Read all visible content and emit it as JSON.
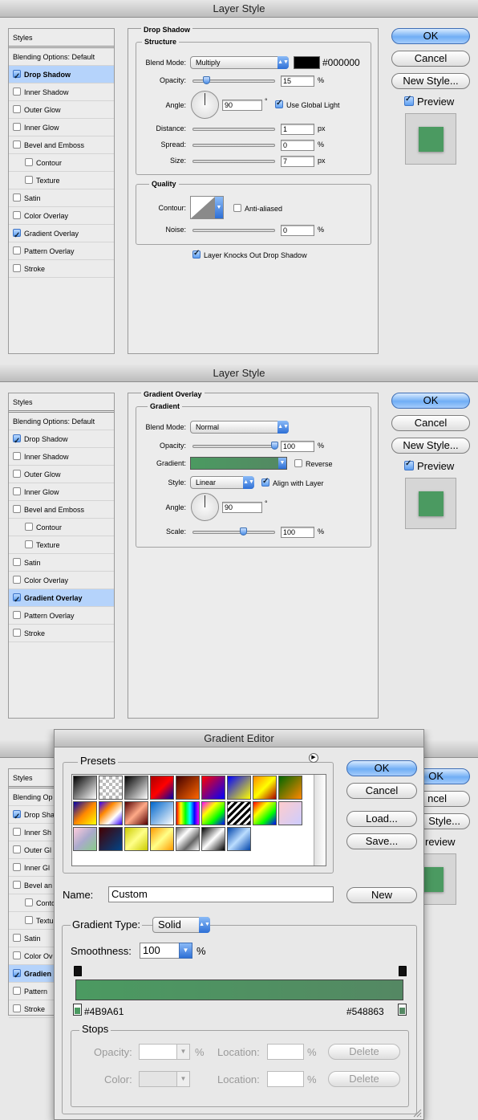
{
  "dialog1": {
    "title": "Layer Style",
    "list": [
      {
        "label": "Styles",
        "type": "header"
      },
      {
        "label": "Blending Options: Default",
        "type": "plain"
      },
      {
        "label": "Drop Shadow",
        "checked": true,
        "selected": true
      },
      {
        "label": "Inner Shadow",
        "checked": false
      },
      {
        "label": "Outer Glow",
        "checked": false
      },
      {
        "label": "Inner Glow",
        "checked": false
      },
      {
        "label": "Bevel and Emboss",
        "checked": false
      },
      {
        "label": "Contour",
        "checked": false,
        "indent": true
      },
      {
        "label": "Texture",
        "checked": false,
        "indent": true
      },
      {
        "label": "Satin",
        "checked": false
      },
      {
        "label": "Color Overlay",
        "checked": false
      },
      {
        "label": "Gradient Overlay",
        "checked": true
      },
      {
        "label": "Pattern Overlay",
        "checked": false
      },
      {
        "label": "Stroke",
        "checked": false
      }
    ],
    "section_title": "Drop Shadow",
    "structure": "Structure",
    "blend_mode_label": "Blend Mode:",
    "blend_mode": "Multiply",
    "shadow_color_hex": "#000000",
    "opacity_label": "Opacity:",
    "opacity": "15",
    "opacity_pct": 15,
    "percent": "%",
    "angle_label": "Angle:",
    "angle": "90",
    "degree": "°",
    "use_global_light": "Use Global Light",
    "distance_label": "Distance:",
    "distance": "1",
    "distance_pct": 1,
    "spread_label": "Spread:",
    "spread": "0",
    "spread_pct": 0,
    "size_label": "Size:",
    "size": "7",
    "size_pct": 7,
    "px": "px",
    "quality": "Quality",
    "contour_label": "Contour:",
    "anti_aliased": "Anti-aliased",
    "noise_label": "Noise:",
    "noise": "0",
    "noise_pct": 0,
    "knocks_out": "Layer Knocks Out Drop Shadow",
    "ok": "OK",
    "cancel": "Cancel",
    "new_style": "New Style...",
    "preview": "Preview",
    "preview_color": "#4b9a61"
  },
  "dialog2": {
    "title": "Layer Style",
    "list": [
      {
        "label": "Styles",
        "type": "header"
      },
      {
        "label": "Blending Options: Default",
        "type": "plain"
      },
      {
        "label": "Drop Shadow",
        "checked": true
      },
      {
        "label": "Inner Shadow",
        "checked": false
      },
      {
        "label": "Outer Glow",
        "checked": false
      },
      {
        "label": "Inner Glow",
        "checked": false
      },
      {
        "label": "Bevel and Emboss",
        "checked": false
      },
      {
        "label": "Contour",
        "checked": false,
        "indent": true
      },
      {
        "label": "Texture",
        "checked": false,
        "indent": true
      },
      {
        "label": "Satin",
        "checked": false
      },
      {
        "label": "Color Overlay",
        "checked": false
      },
      {
        "label": "Gradient Overlay",
        "checked": true,
        "selected": true
      },
      {
        "label": "Pattern Overlay",
        "checked": false
      },
      {
        "label": "Stroke",
        "checked": false
      }
    ],
    "section_title": "Gradient Overlay",
    "gradient": "Gradient",
    "blend_mode_label": "Blend Mode:",
    "blend_mode": "Normal",
    "opacity_label": "Opacity:",
    "opacity": "100",
    "opacity_pct": 100,
    "percent": "%",
    "gradient_label": "Gradient:",
    "reverse": "Reverse",
    "style_label": "Style:",
    "style": "Linear",
    "align_with_layer": "Align with Layer",
    "angle_label": "Angle:",
    "angle": "90",
    "degree": "°",
    "scale_label": "Scale:",
    "scale": "100",
    "scale_pct": 50,
    "ok": "OK",
    "cancel": "Cancel",
    "new_style": "New Style...",
    "preview": "Preview"
  },
  "dialog3_background_list": [
    "Styles",
    "Blending Op",
    "Drop Sha",
    "Inner Sh",
    "Outer Gl",
    "Inner Gl",
    "Bevel an",
    "Conto",
    "Textu",
    "Satin",
    "Color Ov",
    "Gradien",
    "Pattern",
    "Stroke"
  ],
  "dialog3_background_buttons": {
    "ok": "OK",
    "cancel": "ncel",
    "new_style": "Style...",
    "preview": "review"
  },
  "gradient_editor": {
    "title": "Gradient Editor",
    "presets": "Presets",
    "ok": "OK",
    "cancel": "Cancel",
    "load": "Load...",
    "save": "Save...",
    "name_label": "Name:",
    "name": "Custom",
    "new": "New",
    "gradient_type_label": "Gradient Type:",
    "gradient_type": "Solid",
    "smoothness_label": "Smoothness:",
    "smoothness": "100",
    "percent": "%",
    "left_color": "#4B9A61",
    "right_color": "#548863",
    "stops": "Stops",
    "opacity_label": "Opacity:",
    "location_label": "Location:",
    "delete": "Delete",
    "color_label": "Color:"
  }
}
